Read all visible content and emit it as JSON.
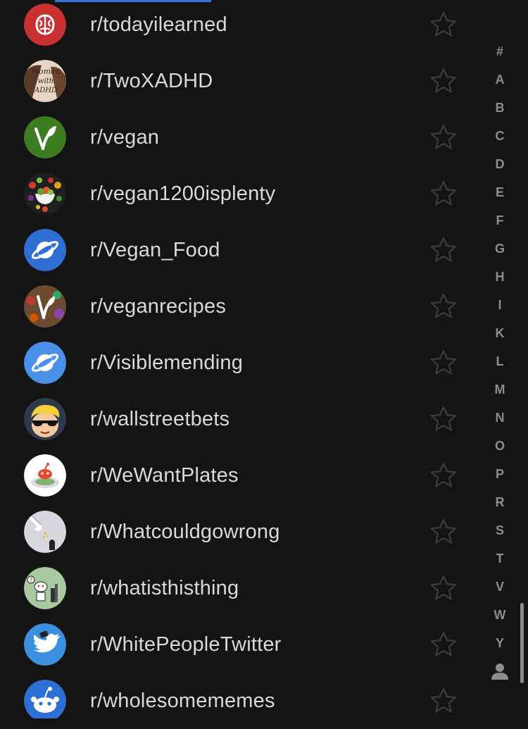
{
  "subreddits": [
    {
      "name": "r/todayilearned",
      "icon": "brain-icon"
    },
    {
      "name": "r/TwoXADHD",
      "icon": "women-with-adhd-icon",
      "icon_text": [
        "Women",
        "with",
        "ADHD"
      ]
    },
    {
      "name": "r/vegan",
      "icon": "vegan-leaf-icon"
    },
    {
      "name": "r/vegan1200isplenty",
      "icon": "vegetable-bowl-icon"
    },
    {
      "name": "r/Vegan_Food",
      "icon": "planet-icon"
    },
    {
      "name": "r/veganrecipes",
      "icon": "vegan-recipes-leaf-icon"
    },
    {
      "name": "r/Visiblemending",
      "icon": "planet-icon"
    },
    {
      "name": "r/wallstreetbets",
      "icon": "wsb-guy-icon"
    },
    {
      "name": "r/WeWantPlates",
      "icon": "snoo-plate-icon"
    },
    {
      "name": "r/Whatcouldgowrong",
      "icon": "dropping-hand-icon"
    },
    {
      "name": "r/whatisthisthing",
      "icon": "snoo-question-icon"
    },
    {
      "name": "r/WhitePeopleTwitter",
      "icon": "twitter-bird-icon"
    },
    {
      "name": "r/wholesomememes",
      "icon": "snoo-icon"
    }
  ],
  "index_letters": [
    "#",
    "A",
    "B",
    "C",
    "D",
    "E",
    "F",
    "G",
    "H",
    "I",
    "K",
    "L",
    "M",
    "N",
    "O",
    "P",
    "R",
    "S",
    "T",
    "V",
    "W",
    "Y"
  ],
  "colors": {
    "background": "#141414",
    "text": "#d9d9d9",
    "index_text": "#8d8d8d",
    "accent": "#2f73d9",
    "star_outline": "#3a3a3a"
  }
}
